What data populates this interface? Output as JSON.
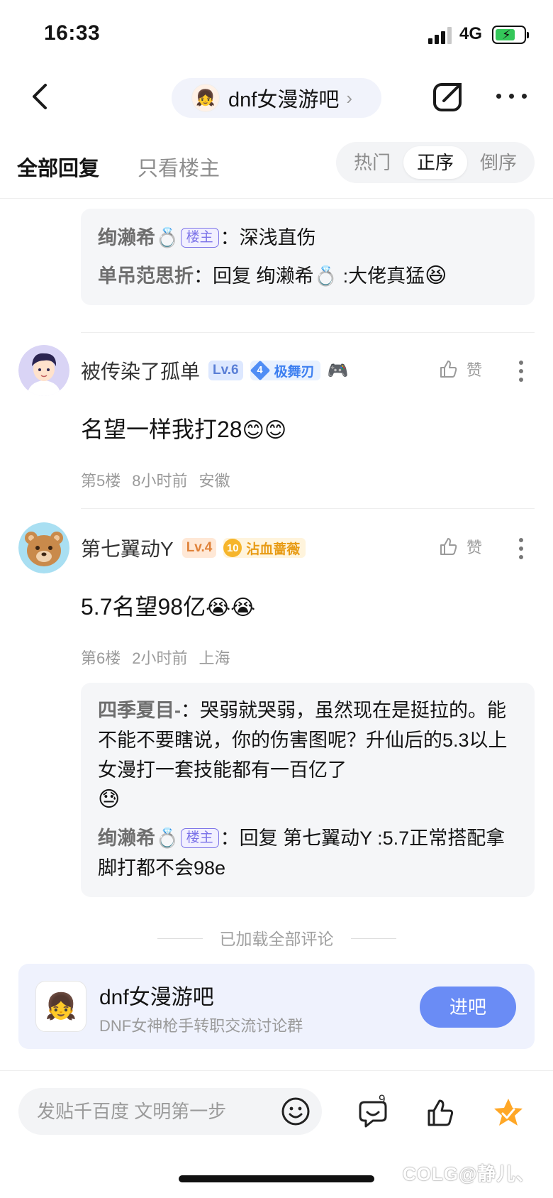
{
  "status_bar": {
    "time": "16:33",
    "network": "4G"
  },
  "header": {
    "forum_name": "dnf女漫游吧"
  },
  "tabs": {
    "all": "全部回复",
    "owner_only": "只看楼主"
  },
  "sort": {
    "hot": "热门",
    "asc": "正序",
    "desc": "倒序",
    "selected": "正序"
  },
  "top_subreplies": [
    {
      "user": "绚濑希",
      "tag": "楼主",
      "text": "：深浅直伤"
    },
    {
      "user": "单吊范思折",
      "text": "：回复 绚濑希",
      "text2": " :大佬真猛"
    }
  ],
  "posts": [
    {
      "username": "被传染了孤单",
      "level": "Lv.6",
      "title_num": "4",
      "title": "极舞刃",
      "body": "名望一样我打28",
      "floor": "第5楼",
      "time": "8小时前",
      "location": "安徽",
      "like_label": "赞"
    },
    {
      "username": "第七翼动Y",
      "level": "Lv.4",
      "title_num": "10",
      "title": "沾血蔷薇",
      "body": "5.7名望98亿",
      "floor": "第6楼",
      "time": "2小时前",
      "location": "上海",
      "like_label": "赞",
      "subreplies": [
        {
          "user": "四季夏目-",
          "text": "：哭弱就哭弱，虽然现在是挺拉的。能不能不要瞎说，你的伤害图呢？升仙后的5.3以上女漫打一套技能都有一百亿了"
        },
        {
          "user": "绚濑希",
          "tag": "楼主",
          "text": "：回复 第七翼动Y :5.7正常搭配拿脚打都不会98e"
        }
      ]
    }
  ],
  "loaded_all": "已加载全部评论",
  "forum_card": {
    "name": "dnf女漫游吧",
    "desc": "DNF女神枪手转职交流讨论群",
    "button": "进吧"
  },
  "bottom_bar": {
    "placeholder": "发贴千百度 文明第一步",
    "comment_count": "9"
  },
  "watermark": "COLG@静儿、",
  "colors": {
    "accent": "#6a8cf5",
    "owner_tag": "#7b72e8",
    "star": "#ffa726"
  }
}
